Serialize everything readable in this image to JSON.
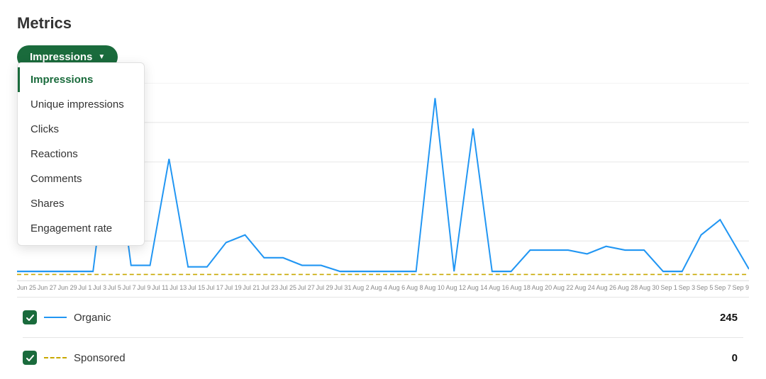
{
  "page": {
    "title": "Metrics"
  },
  "dropdown": {
    "button_label": "Impressions",
    "arrow": "▼",
    "items": [
      {
        "label": "Impressions",
        "active": true
      },
      {
        "label": "Unique impressions",
        "active": false
      },
      {
        "label": "Clicks",
        "active": false
      },
      {
        "label": "Reactions",
        "active": false
      },
      {
        "label": "Comments",
        "active": false
      },
      {
        "label": "Shares",
        "active": false
      },
      {
        "label": "Engagement rate",
        "active": false
      }
    ]
  },
  "legend": {
    "organic": {
      "label": "Organic",
      "value": "245"
    },
    "sponsored": {
      "label": "Sponsored",
      "value": "0"
    }
  },
  "xaxis": {
    "labels": [
      "Jun 25",
      "Jun 27",
      "Jun 29",
      "Jul 1",
      "Jul 3",
      "Jul 5",
      "Jul 7",
      "Jul 9",
      "Jul 11",
      "Jul 13",
      "Jul 15",
      "Jul 17",
      "Jul 19",
      "Jul 21",
      "Jul 23",
      "Jul 25",
      "Jul 27",
      "Jul 29",
      "Jul 31",
      "Aug 2",
      "Aug 4",
      "Aug 6",
      "Aug 8",
      "Aug 10",
      "Aug 12",
      "Aug 14",
      "Aug 16",
      "Aug 18",
      "Aug 20",
      "Aug 22",
      "Aug 24",
      "Aug 26",
      "Aug 28",
      "Aug 30",
      "Sep 1",
      "Sep 3",
      "Sep 5",
      "Sep 7",
      "Sep 9"
    ]
  }
}
